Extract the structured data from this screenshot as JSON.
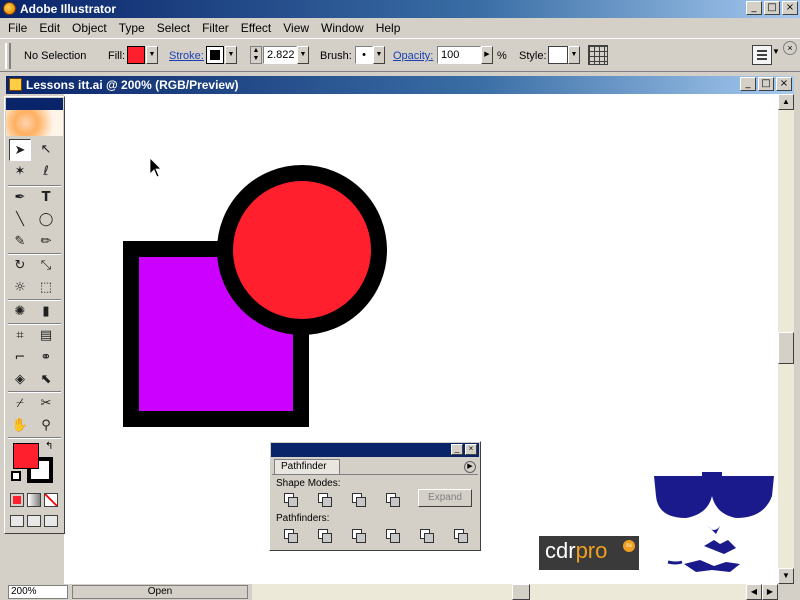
{
  "app": {
    "title": "Adobe Illustrator"
  },
  "window_buttons": {
    "minimize": "_",
    "maximize": "□",
    "close": "×"
  },
  "menu": [
    "File",
    "Edit",
    "Object",
    "Type",
    "Select",
    "Filter",
    "Effect",
    "View",
    "Window",
    "Help"
  ],
  "control": {
    "selection": "No Selection",
    "fill_label": "Fill:",
    "fill_color": "#ff1f2d",
    "stroke_label": "Stroke:",
    "stroke_weight": "2.822",
    "brush_label": "Brush:",
    "brush_value": "•",
    "opacity_label": "Opacity:",
    "opacity_value": "100",
    "opacity_unit": "%",
    "style_label": "Style:"
  },
  "document": {
    "title": "Lessons itt.ai @ 200% (RGB/Preview)",
    "zoom": "200%",
    "status": "Open"
  },
  "artwork": {
    "square_fill": "#cc00ff",
    "circle_fill": "#ff1f2d",
    "stroke_color": "#000000"
  },
  "tools": {
    "selection": "➤",
    "direct_selection": "↖",
    "magic_wand": "✶",
    "lasso": "ℓ",
    "pen": "✒",
    "type": "T",
    "line": "╲",
    "ellipse": "◯",
    "paintbrush": "✎",
    "pencil": "✏",
    "rotate": "↻",
    "scale": "⤡",
    "warp": "☼",
    "free_transform": "⬚",
    "symbol_sprayer": "✺",
    "graph": "▮",
    "mesh": "⌗",
    "gradient": "▤",
    "eyedropper": "⌐",
    "blend": "⚭",
    "live_paint": "◈",
    "live_paint_select": "⬉",
    "slice": "⌿",
    "scissors": "✂",
    "hand": "✋",
    "zoom": "⚲",
    "swap": "↰"
  },
  "pathfinder": {
    "title": "Pathfinder",
    "menu_arrow": "▶",
    "shape_modes_label": "Shape Modes:",
    "expand_label": "Expand",
    "pathfinders_label": "Pathfinders:"
  },
  "logo": {
    "part1": "cdr",
    "part2": "pro",
    "badge": "ru"
  },
  "colors": {
    "title_bar": "#0a246a",
    "chrome": "#d4d0c8",
    "link": "#1a3fb0",
    "face_blue": "#1a1a8c"
  }
}
